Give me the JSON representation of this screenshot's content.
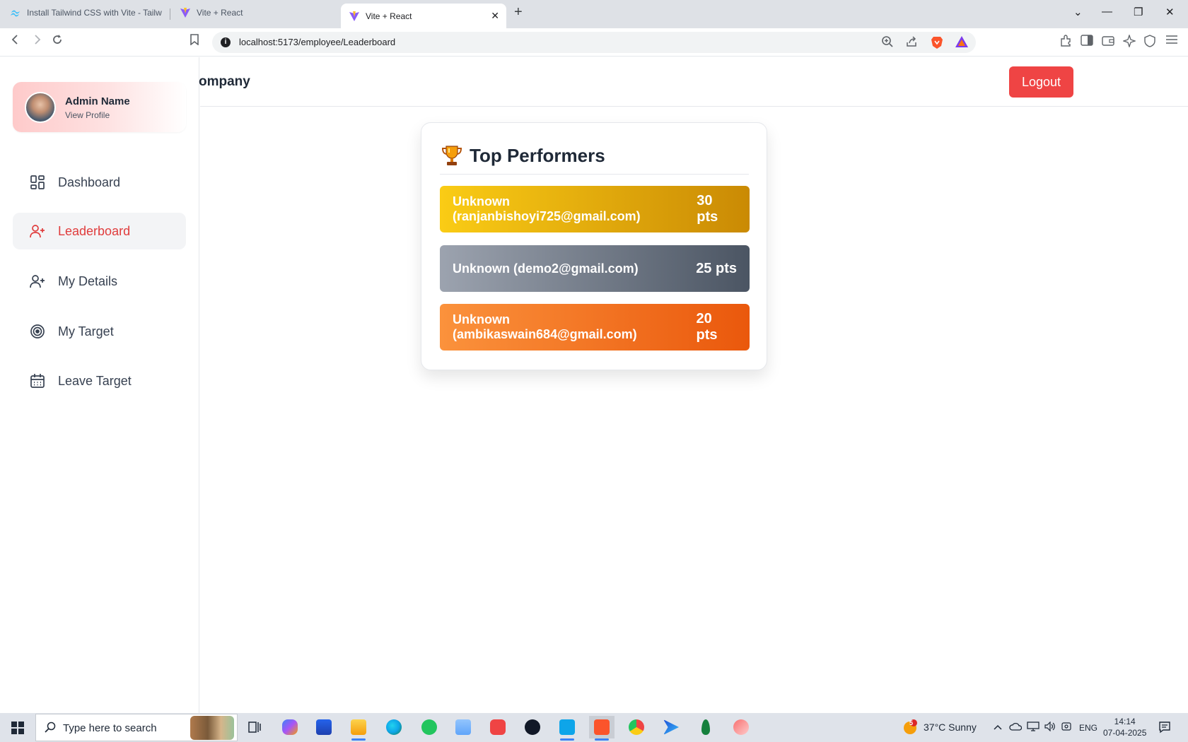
{
  "browser": {
    "tabs": [
      {
        "label": "Install Tailwind CSS with Vite - Tailw"
      },
      {
        "label": "Vite + React"
      },
      {
        "label": "Vite + React"
      }
    ],
    "url": "localhost:5173/employee/Leaderboard"
  },
  "sidebar": {
    "profile": {
      "name": "Admin Name",
      "link": "View Profile"
    },
    "items": [
      {
        "label": "Dashboard"
      },
      {
        "label": "Leaderboard",
        "active": true
      },
      {
        "label": "My Details"
      },
      {
        "label": "My Target"
      },
      {
        "label": "Leave Target"
      }
    ]
  },
  "header": {
    "company": "ompany",
    "logout_label": "Logout"
  },
  "leaderboard": {
    "title": "Top Performers",
    "entries": [
      {
        "name": "Unknown (ranjanbishoyi725@gmail.com)",
        "points": "30 pts",
        "color_from": "#facc15",
        "color_to": "#ca8a04"
      },
      {
        "name": "Unknown (demo2@gmail.com)",
        "points": "25 pts",
        "color_from": "#9ca3af",
        "color_to": "#4b5563"
      },
      {
        "name": "Unknown (ambikaswain684@gmail.com)",
        "points": "20 pts",
        "color_from": "#fb923c",
        "color_to": "#ea580c"
      }
    ]
  },
  "taskbar": {
    "search_placeholder": "Type here to search",
    "weather": "37°C  Sunny",
    "weather_badge": "5",
    "language": "ENG",
    "time": "14:14",
    "date": "07-04-2025"
  },
  "colors": {
    "accent": "#ef4444",
    "active_nav": "#e03c3c"
  }
}
